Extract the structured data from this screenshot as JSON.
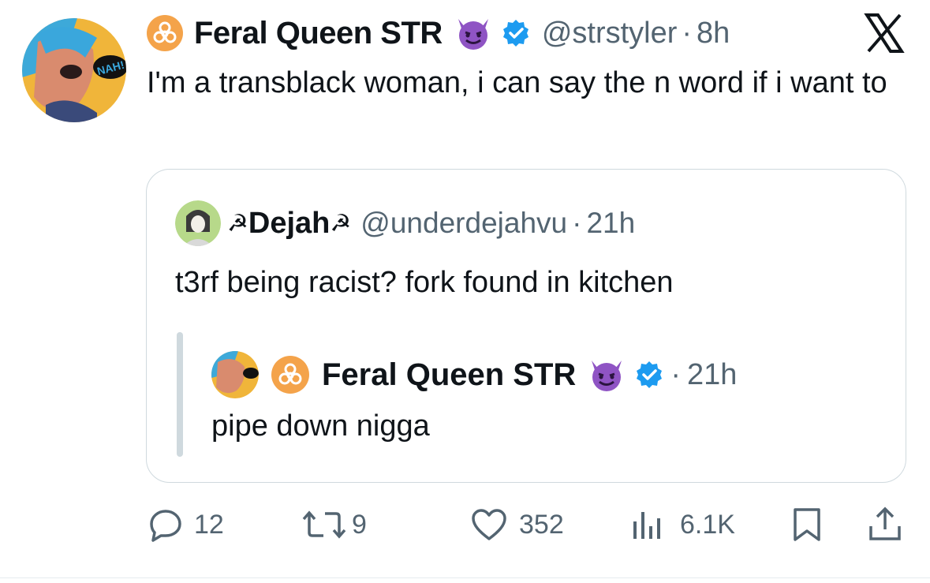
{
  "tweet": {
    "author_name": "Feral Queen STR",
    "handle": "@strstyler",
    "time": "8h",
    "text": "I'm a transblack woman, i can say the n word if i want to"
  },
  "quote": {
    "author_name": "Dejah",
    "name_prefix": "☭",
    "name_suffix": "☭",
    "handle": "@underdejahvu",
    "time": "21h",
    "text": "t3rf being racist? fork found in kitchen",
    "nested": {
      "author_name": "Feral Queen STR",
      "time": "21h",
      "text": "pipe down nigga"
    }
  },
  "actions": {
    "replies": "12",
    "reposts": "9",
    "likes": "352",
    "views": "6.1K"
  },
  "avatar_main_label": "NAH!",
  "colors": {
    "text": "#0f1419",
    "secondary": "#536471",
    "verified": "#1d9bf0",
    "hazard": "#f4a34a",
    "devil": "#8f54c4",
    "border": "#cfd9de"
  },
  "icons": [
    "biohazard-icon",
    "devil-emoji-icon",
    "verified-badge-icon",
    "x-logo-icon",
    "reply-icon",
    "repost-icon",
    "like-icon",
    "views-icon",
    "bookmark-icon",
    "share-icon"
  ]
}
